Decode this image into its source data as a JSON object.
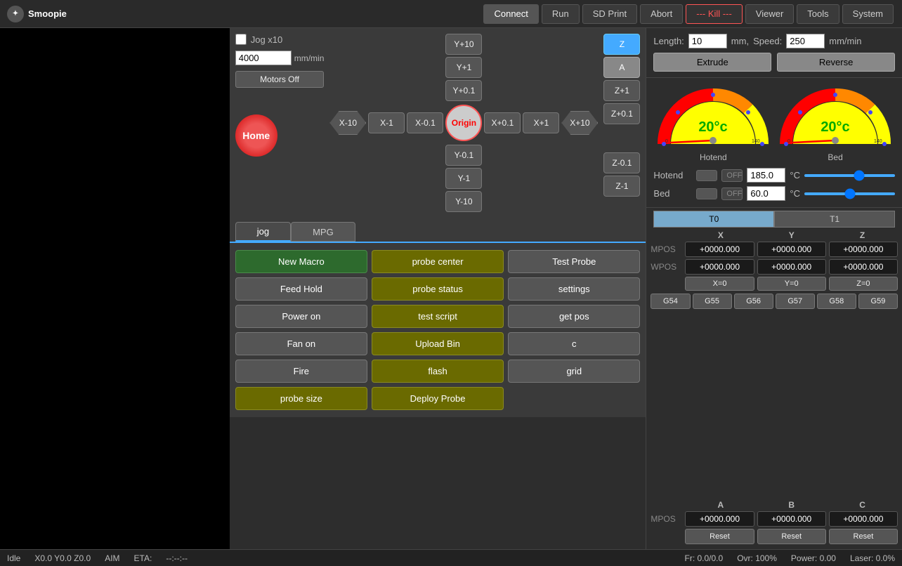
{
  "app": {
    "title": "Smoopie"
  },
  "nav": {
    "connect": "Connect",
    "run": "Run",
    "sd_print": "SD Print",
    "abort": "Abort",
    "kill": "--- Kill ---",
    "viewer": "Viewer",
    "tools": "Tools",
    "system": "System"
  },
  "jog": {
    "x_label": "Jog x10",
    "speed_value": "4000",
    "speed_unit": "mm/min",
    "motors_off": "Motors Off",
    "y_plus_10": "Y+10",
    "y_plus_1": "Y+1",
    "y_plus_01": "Y+0.1",
    "y_minus_01": "Y-0.1",
    "y_minus_1": "Y-1",
    "y_minus_10": "Y-10",
    "x_minus_10": "X-10",
    "x_minus_1": "X-1",
    "x_minus_01": "X-0.1",
    "origin": "Origin",
    "x_plus_01": "X+0.1",
    "x_plus_1": "X+1",
    "x_plus_10": "X+10",
    "z_label": "Z",
    "a_label": "A",
    "z_plus_1": "Z+1",
    "z_plus_01": "Z+0.1",
    "z_minus_01": "Z-0.1",
    "z_minus_1": "Z-1",
    "home": "Home"
  },
  "tabs": {
    "jog": "jog",
    "mpg": "MPG"
  },
  "macros": [
    {
      "label": "New Macro",
      "style": "green"
    },
    {
      "label": "probe center",
      "style": "olive"
    },
    {
      "label": "Test Probe",
      "style": "gray"
    },
    {
      "label": "Feed Hold",
      "style": "gray"
    },
    {
      "label": "probe status",
      "style": "olive"
    },
    {
      "label": "settings",
      "style": "gray"
    },
    {
      "label": "Power on",
      "style": "gray"
    },
    {
      "label": "test script",
      "style": "olive"
    },
    {
      "label": "get pos",
      "style": "gray"
    },
    {
      "label": "Fan on",
      "style": "gray"
    },
    {
      "label": "Upload Bin",
      "style": "olive"
    },
    {
      "label": "c",
      "style": "gray"
    },
    {
      "label": "Fire",
      "style": "gray"
    },
    {
      "label": "flash",
      "style": "olive"
    },
    {
      "label": "grid",
      "style": "gray"
    },
    {
      "label": "probe size",
      "style": "olive"
    },
    {
      "label": "Deploy Probe",
      "style": "olive"
    }
  ],
  "extrude": {
    "length_label": "Length:",
    "length_value": "10",
    "length_unit": "mm,",
    "speed_label": "Speed:",
    "speed_value": "250",
    "speed_unit": "mm/min",
    "extrude_btn": "Extrude",
    "reverse_btn": "Reverse"
  },
  "hotend": {
    "label": "Hotend",
    "gauge_temp": "20°c",
    "toggle": "OFF",
    "target": "185.0",
    "unit": "°C"
  },
  "bed": {
    "label": "Bed",
    "gauge_temp": "20°c",
    "toggle": "OFF",
    "target": "60.0",
    "unit": "°C"
  },
  "tools": {
    "t0": "T0",
    "t1": "T1"
  },
  "position": {
    "x_header": "X",
    "y_header": "Y",
    "z_header": "Z",
    "mpos_label": "MPOS",
    "wpos_label": "WPOS",
    "mpos_x": "+0000.000",
    "mpos_y": "+0000.000",
    "mpos_z": "+0000.000",
    "wpos_x": "+0000.000",
    "wpos_y": "+0000.000",
    "wpos_z": "+0000.000",
    "x_zero": "X=0",
    "y_zero": "Y=0",
    "z_zero": "Z=0",
    "g54": "G54",
    "g55": "G55",
    "g56": "G56",
    "g57": "G57",
    "g58": "G58",
    "g59": "G59"
  },
  "abc": {
    "a_header": "A",
    "b_header": "B",
    "c_header": "C",
    "mpos_label": "MPOS",
    "mpos_a": "+0000.000",
    "mpos_b": "+0000.000",
    "mpos_c": "+0000.000",
    "reset": "Reset"
  },
  "status_bar": {
    "state": "Idle",
    "pos": "X0.0 Y0.0 Z0.0",
    "aim": "AIM",
    "eta_label": "ETA:",
    "eta_value": "--:--:--",
    "fr": "Fr: 0.0/0.0",
    "ovr": "Ovr: 100%",
    "power": "Power: 0.00",
    "laser": "Laser: 0.0%"
  }
}
